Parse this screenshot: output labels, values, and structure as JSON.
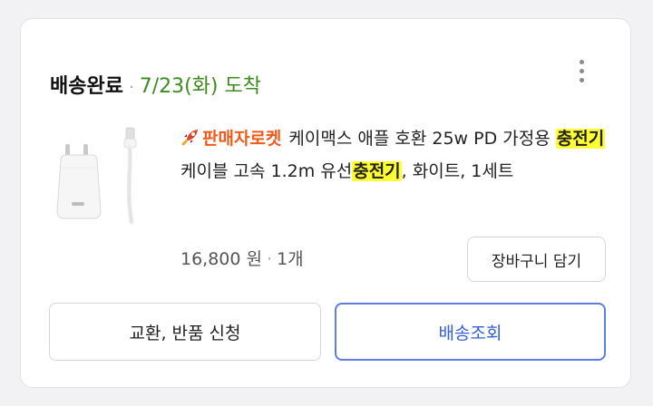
{
  "order": {
    "status": "배송완료",
    "separator": "·",
    "arrival": "7/23(화) 도착",
    "more_icon": "more-vertical-icon"
  },
  "product": {
    "badge": "판매자로켓",
    "badge_icon": "rocket-icon",
    "title_parts": {
      "p1": "케이맥스 애플 호환 25w PD 가정용 ",
      "h1": "충전기",
      "p2": " 케이블 고속 1.2m 유선",
      "h2": "충전기",
      "p3": ", 화이트, 1세트"
    },
    "price": "16,800 원",
    "price_separator": "·",
    "quantity": "1개"
  },
  "buttons": {
    "add_to_cart": "장바구니 담기",
    "exchange_return": "교환, 반품 신청",
    "track_delivery": "배송조회"
  },
  "colors": {
    "arrival": "#3d8c1f",
    "badge": "#f05a1a",
    "highlight": "#ffff33",
    "track_border": "#5b7ee0",
    "track_text": "#3360d6"
  }
}
